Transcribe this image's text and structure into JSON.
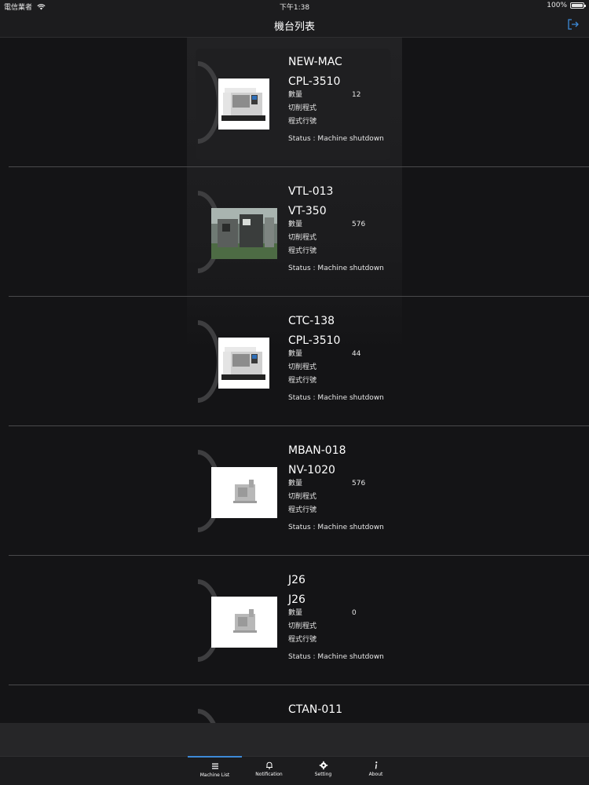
{
  "status_bar": {
    "carrier": "電信業者",
    "time": "下午1:38",
    "battery": "100%"
  },
  "nav": {
    "title": "機台列表"
  },
  "labels": {
    "quantity": "數量",
    "cutting_program": "切削程式",
    "program_line": "程式行號"
  },
  "machines": [
    {
      "id": "NEW-MAC",
      "model": "CPL-3510",
      "quantity": "12",
      "status": "Status : Machine shutdown",
      "image": "lathe"
    },
    {
      "id": "VTL-013",
      "model": "VT-350",
      "quantity": "576",
      "status": "Status : Machine shutdown",
      "image": "photo"
    },
    {
      "id": "CTC-138",
      "model": "CPL-3510",
      "quantity": "44",
      "status": "Status : Machine shutdown",
      "image": "lathe"
    },
    {
      "id": "MBAN-018",
      "model": "NV-1020",
      "quantity": "576",
      "status": "Status : Machine shutdown",
      "image": "placeholder"
    },
    {
      "id": "J26",
      "model": "J26",
      "quantity": "0",
      "status": "Status : Machine shutdown",
      "image": "placeholder"
    },
    {
      "id": "CTAN-011"
    }
  ],
  "tabs": [
    {
      "label": "Machine List",
      "icon": "list-icon"
    },
    {
      "label": "Notification",
      "icon": "bell-icon"
    },
    {
      "label": "Setting",
      "icon": "gear-icon"
    },
    {
      "label": "About",
      "icon": "info-icon"
    }
  ],
  "colors": {
    "background": "#141416",
    "bar": "#1c1c1e",
    "accent": "#3d8ad8"
  }
}
